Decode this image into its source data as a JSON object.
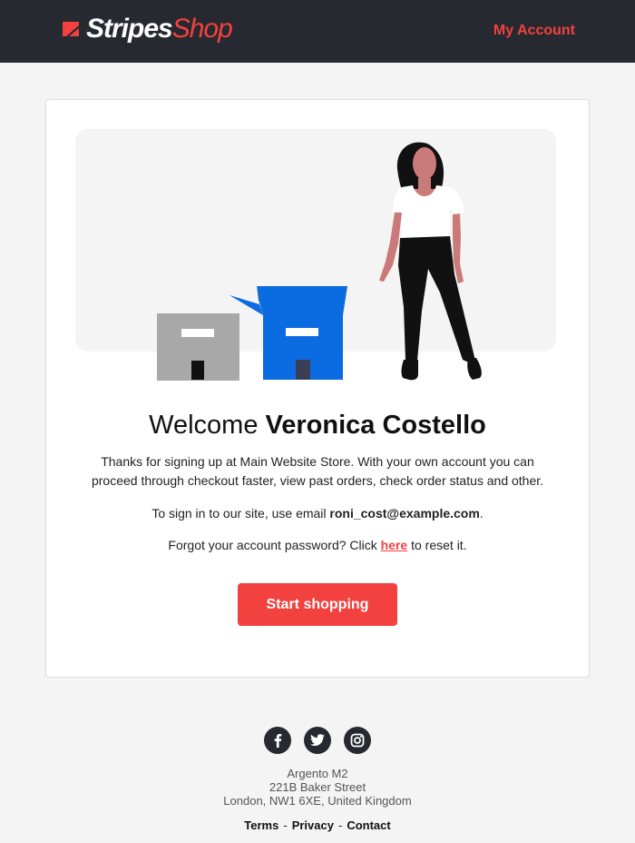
{
  "header": {
    "logo_part1": "Stripes",
    "logo_part2": "Shop",
    "my_account": "My Account"
  },
  "colors": {
    "accent": "#f2413f",
    "header_bg": "#262930",
    "page_bg": "#f4f4f4",
    "box_blue": "#0b6be1",
    "box_gray": "#a8a8a8"
  },
  "main": {
    "welcome_prefix": "Welcome ",
    "customer_name": "Veronica Costello",
    "intro": "Thanks for signing up at Main Website Store. With your own account you can proceed through checkout faster, view past orders, check order status and other.",
    "signin_prefix": "To sign in to our site, use email ",
    "email": "roni_cost@example.com",
    "signin_suffix": ".",
    "forgot_prefix": "Forgot your account password? Click ",
    "here_link": "here",
    "forgot_suffix": " to reset it.",
    "cta": "Start shopping"
  },
  "footer": {
    "social": [
      {
        "icon": "facebook-icon"
      },
      {
        "icon": "twitter-icon"
      },
      {
        "icon": "instagram-icon"
      }
    ],
    "address": [
      "Argento M2",
      "221B Baker Street",
      "London, NW1 6XE, United Kingdom"
    ],
    "links": [
      "Terms",
      "Privacy",
      "Contact"
    ],
    "separator": "-"
  }
}
